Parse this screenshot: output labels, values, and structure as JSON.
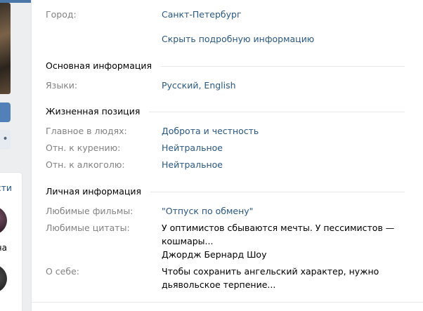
{
  "left": {
    "block_title_fragment": "сти",
    "friend_name_fragment": "на",
    "more_glyph": "•"
  },
  "info": {
    "city": {
      "label": "Город:",
      "value": "Санкт-Петербург"
    },
    "hide_link": "Скрыть подробную информацию",
    "basic": {
      "title": "Основная информация",
      "languages": {
        "label": "Языки:",
        "value": "Русский, English"
      }
    },
    "life": {
      "title": "Жизненная позиция",
      "people": {
        "label": "Главное в людях:",
        "value": "Доброта и честность"
      },
      "smoking": {
        "label": "Отн. к курению:",
        "value": "Нейтральное"
      },
      "alcohol": {
        "label": "Отн. к алкоголю:",
        "value": "Нейтральное"
      }
    },
    "personal": {
      "title": "Личная информация",
      "movies": {
        "label": "Любимые фильмы:",
        "value": "\"Отпуск по обмену\""
      },
      "quotes": {
        "label": "Любимые цитаты:",
        "line1": "У оптимистов сбываются мечты. У пессимистов —",
        "line2": "кошмары...",
        "line3": "Джордж Бернард Шоу"
      },
      "about": {
        "label": "О себе:",
        "line1": "Чтобы сохранить ангельский характер, нужно",
        "line2": "дьявольское терпение..."
      }
    }
  }
}
